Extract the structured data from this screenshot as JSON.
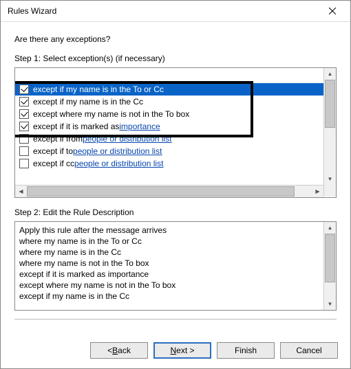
{
  "window": {
    "title": "Rules Wizard"
  },
  "question": "Are there any exceptions?",
  "step1_label": "Step 1: Select exception(s) (if necessary)",
  "step2_label": "Step 2: Edit the Rule Description",
  "exceptions": [
    {
      "label": "except if my name is in the To or Cc",
      "checked": true,
      "selected": true
    },
    {
      "label": "except if my name is in the Cc",
      "checked": true,
      "selected": false
    },
    {
      "label": "except where my name is not in the To box",
      "checked": true,
      "selected": false
    },
    {
      "label": "except if it is marked as ",
      "link": "importance",
      "checked": true,
      "selected": false
    },
    {
      "label": "except if from ",
      "link": "people or distribution list",
      "checked": false,
      "selected": false
    },
    {
      "label": "except if to ",
      "link": "people or distribution list",
      "checked": false,
      "selected": false
    },
    {
      "label": "except if cc ",
      "link": "people or distribution list",
      "checked": false,
      "selected": false
    }
  ],
  "description_lines": [
    "Apply this rule after the message arrives",
    "where my name is in the To or Cc",
    "where my name is in the Cc",
    "where my name is not in the To box",
    "except if it is marked as importance",
    "except where my name is not in the To box",
    "except if my name is in the Cc"
  ],
  "buttons": {
    "back_pre": "< ",
    "back_u": "B",
    "back_post": "ack",
    "next_u": "N",
    "next_post": "ext >",
    "finish": "Finish",
    "cancel": "Cancel"
  }
}
